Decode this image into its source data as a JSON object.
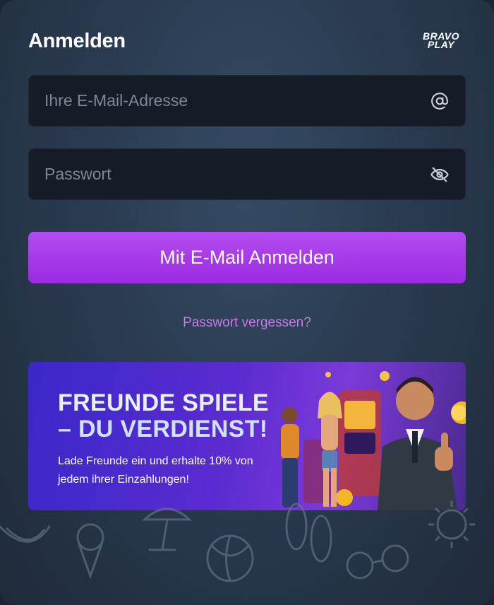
{
  "login": {
    "title": "Anmelden",
    "logo_line1": "BRAVO",
    "logo_line2": "PLAY"
  },
  "email": {
    "placeholder": "Ihre E-Mail-Adresse",
    "icon": "at-icon"
  },
  "password": {
    "placeholder": "Passwort",
    "icon": "eye-off-icon"
  },
  "submit_label": "Mit E-Mail Anmelden",
  "forgot_label": "Passwort vergessen?",
  "banner": {
    "headline_line1": "FREUNDE SPIELE",
    "headline_line2": "– DU VERDIENST!",
    "subtext": "Lade Freunde ein und erhalte 10% von jedem ihrer Einzahlungen!"
  },
  "colors": {
    "accent": "#a93aeb",
    "link": "#c87ae8",
    "field_bg": "#151c28"
  }
}
